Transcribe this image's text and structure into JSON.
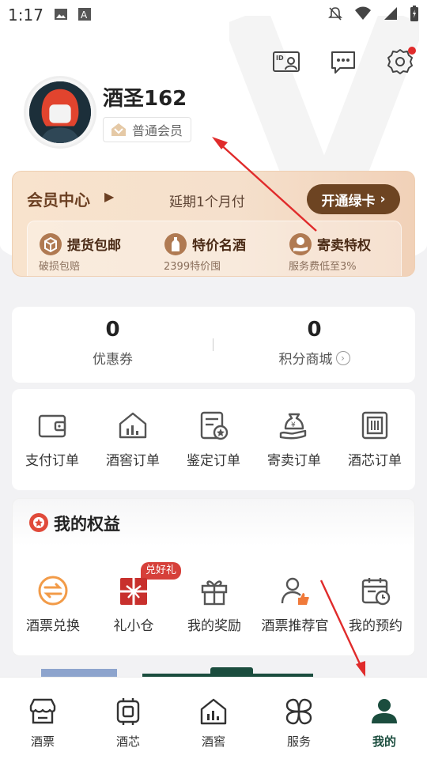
{
  "status_bar": {
    "time": "1:17"
  },
  "profile": {
    "username": "酒圣162",
    "member_level": "普通会员"
  },
  "member_card": {
    "title": "会员中心",
    "subtitle": "延期1个月付",
    "button_label": "开通绿卡",
    "perks": [
      {
        "title": "提货包邮",
        "desc": "破损包赔",
        "icon": "box-icon"
      },
      {
        "title": "特价名酒",
        "desc": "2399特价囤",
        "icon": "bottle-icon"
      },
      {
        "title": "寄卖特权",
        "desc": "服务费低至3%",
        "icon": "hand-coin-icon"
      }
    ]
  },
  "stats": [
    {
      "value": "0",
      "label": "优惠券"
    },
    {
      "value": "0",
      "label": "积分商城"
    }
  ],
  "orders": [
    {
      "label": "支付订单",
      "icon": "wallet-icon"
    },
    {
      "label": "酒窖订单",
      "icon": "cellar-icon"
    },
    {
      "label": "鉴定订单",
      "icon": "certificate-icon"
    },
    {
      "label": "寄卖订单",
      "icon": "money-bag-hand-icon"
    },
    {
      "label": "酒芯订单",
      "icon": "chip-box-icon"
    }
  ],
  "benefits": {
    "title": "我的权益",
    "gift_tag": "兑好礼",
    "items": [
      {
        "label": "酒票兑换",
        "icon": "exchange-icon"
      },
      {
        "label": "礼小仓",
        "icon": "gift-box-icon"
      },
      {
        "label": "我的奖励",
        "icon": "gift-icon"
      },
      {
        "label": "酒票推荐官",
        "icon": "recommender-icon"
      },
      {
        "label": "我的预约",
        "icon": "calendar-icon"
      }
    ]
  },
  "tabs": [
    {
      "label": "酒票",
      "icon": "store-icon",
      "active": false
    },
    {
      "label": "酒芯",
      "icon": "chip-icon",
      "active": false
    },
    {
      "label": "酒窖",
      "icon": "cellar-house-icon",
      "active": false
    },
    {
      "label": "服务",
      "icon": "services-icon",
      "active": false
    },
    {
      "label": "我的",
      "icon": "profile-icon",
      "active": true
    }
  ],
  "colors": {
    "brand_green": "#1b4d3e",
    "gold_dark": "#6d4422",
    "accent_red": "#e02b2b",
    "orange": "#f29b48"
  }
}
